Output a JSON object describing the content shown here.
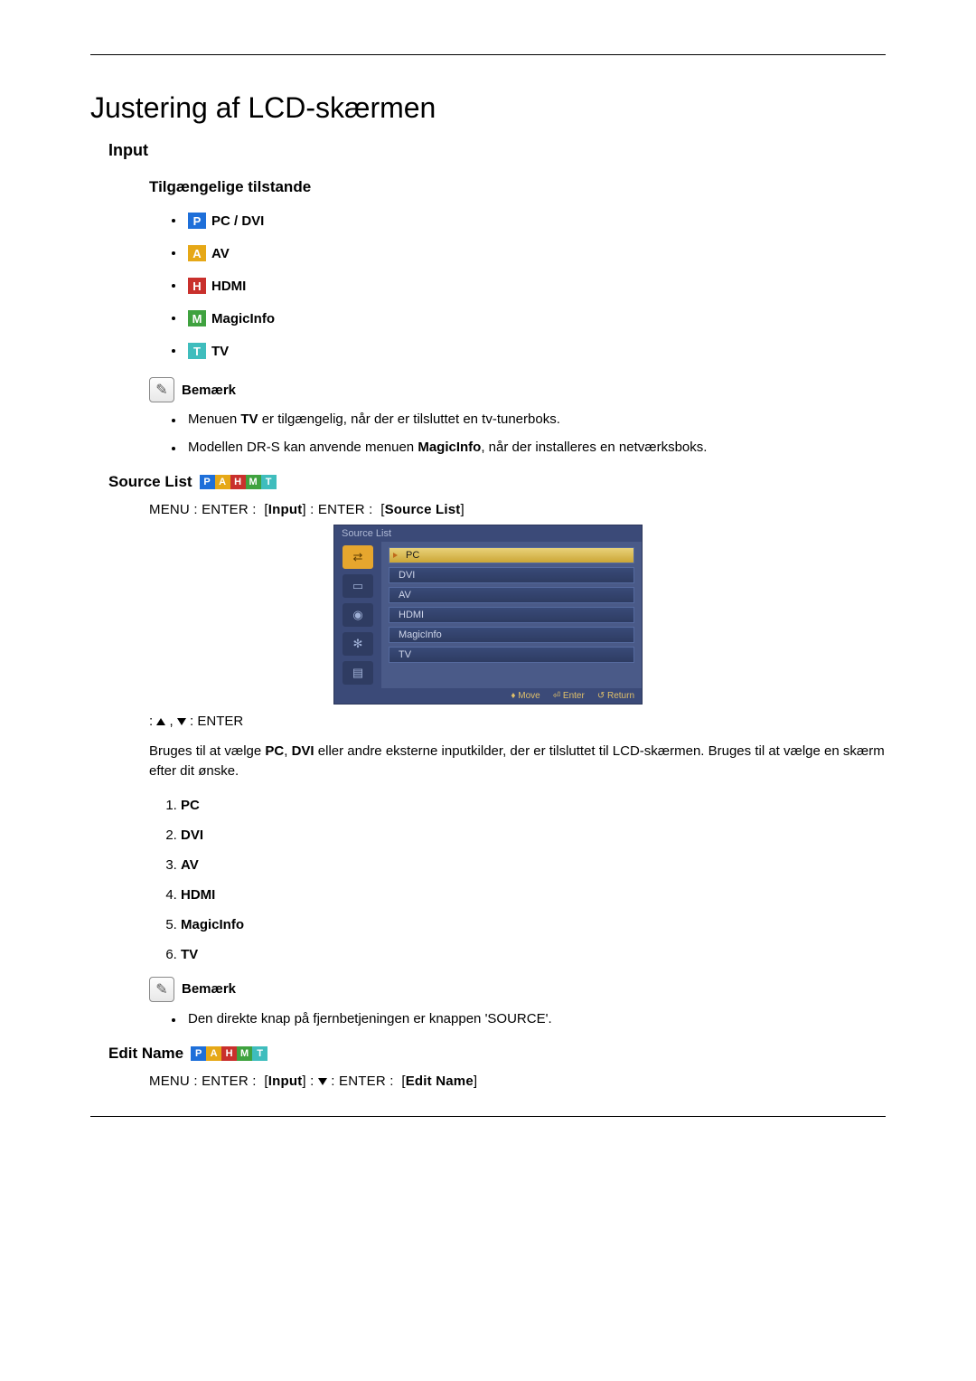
{
  "title": "Justering af LCD-skærmen",
  "section_input": "Input",
  "subsection_modes": "Tilgængelige tilstande",
  "modes": {
    "pc_dvi": "PC / DVI",
    "av": "AV",
    "hdmi": "HDMI",
    "magicinfo": "MagicInfo",
    "tv": "TV"
  },
  "badges": {
    "P": "P",
    "A": "A",
    "H": "H",
    "M": "M",
    "T": "T"
  },
  "note_label": "Bemærk",
  "note1_items": {
    "a_pre": "Menuen ",
    "a_bold": "TV",
    "a_post": " er tilgængelig, når der er tilsluttet en tv-tunerboks.",
    "b_pre": "Modellen DR-S kan anvende menuen ",
    "b_bold": "MagicInfo",
    "b_post": ", når der installeres en netværksboks."
  },
  "source_list_h": "Source List",
  "menu_path1": {
    "menu": "MENU",
    "enter": "ENTER",
    "input": "Input",
    "enter2": "ENTER",
    "source": "Source List"
  },
  "osd": {
    "title": "Source List",
    "items": [
      "PC",
      "DVI",
      "AV",
      "HDMI",
      "MagicInfo",
      "TV"
    ],
    "foot_move": "Move",
    "foot_enter": "Enter",
    "foot_return": "Return"
  },
  "nav_enter": "ENTER",
  "para1_pre": "Bruges til at vælge ",
  "para1_b1": "PC",
  "para1_mid1": ", ",
  "para1_b2": "DVI",
  "para1_post": " eller andre eksterne inputkilder, der er tilsluttet til LCD-skærmen. Bruges til at vælge en skærm efter dit ønske.",
  "ol": [
    "PC",
    "DVI",
    "AV",
    "HDMI",
    "MagicInfo",
    "TV"
  ],
  "note2_item": "Den direkte knap på fjernbetjeningen er knappen 'SOURCE'.",
  "edit_name_h": "Edit Name",
  "menu_path2": {
    "menu": "MENU",
    "enter": "ENTER",
    "input": "Input",
    "enter2": "ENTER",
    "edit": "Edit Name"
  }
}
